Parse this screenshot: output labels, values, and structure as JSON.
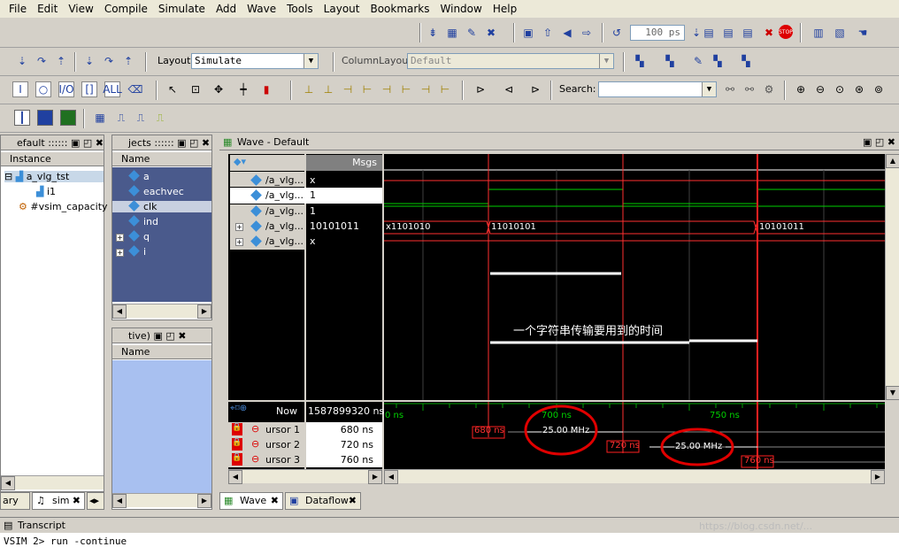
{
  "menu": [
    "File",
    "Edit",
    "View",
    "Compile",
    "Simulate",
    "Add",
    "Wave",
    "Tools",
    "Layout",
    "Bookmarks",
    "Window",
    "Help"
  ],
  "toolbar": {
    "run_length": "100 ps",
    "layout_label": "Layout",
    "layout_value": "Simulate",
    "column_layout_label": "ColumnLayout",
    "column_layout_value": "Default",
    "search_label": "Search:",
    "search_value": ""
  },
  "instance_panel": {
    "title": "efault",
    "header": "Instance",
    "items": [
      "a_vlg_tst",
      "i1",
      "#vsim_capacity"
    ]
  },
  "objects_panel": {
    "title": "jects",
    "header": "Name",
    "items": [
      "a",
      "eachvec",
      "clk",
      "ind",
      "q",
      "i"
    ]
  },
  "active_panel": {
    "title": "tive)",
    "header": "Name"
  },
  "wave": {
    "title": "Wave - Default",
    "msgs_header": "Msgs",
    "signals": [
      {
        "name": "/a_vlg...",
        "value": "x"
      },
      {
        "name": "/a_vlg...",
        "value": "1"
      },
      {
        "name": "/a_vlg...",
        "value": "1"
      },
      {
        "name": "/a_vlg...",
        "value": "10101011"
      },
      {
        "name": "/a_vlg...",
        "value": "x"
      }
    ],
    "bus_labels": [
      "x1101010",
      "11010101",
      "10101011"
    ],
    "annotation": "一个字符串传输要用到的时间",
    "now_label": "Now",
    "now_value": "1587899320 ns",
    "cursors": [
      {
        "name": "ursor 1",
        "value": "680 ns"
      },
      {
        "name": "ursor 2",
        "value": "720 ns"
      },
      {
        "name": "ursor 3",
        "value": "760 ns"
      }
    ],
    "timescale_labels": [
      "0 ns",
      "700 ns",
      "750 ns"
    ],
    "cursor_flags": [
      "680 ns",
      "720 ns",
      "760 ns"
    ],
    "freq_labels": [
      "25.00 MHz",
      "25.00 MHz"
    ]
  },
  "bottom_tabs": {
    "left": [
      "ary",
      "sim"
    ],
    "wave": [
      "Wave",
      "Dataflow"
    ]
  },
  "transcript": {
    "title": "Transcript",
    "line": "VSIM 2> run -continue",
    "watermark": "https://blog.csdn.net/..."
  },
  "colors": {
    "wave_bg": "#000000",
    "signal_green": "#00d000",
    "bus_red": "#ff3030",
    "cursor_red": "#ff2020",
    "panel_blue": "#4a5a8c",
    "annotation_circle": "#e00000"
  }
}
